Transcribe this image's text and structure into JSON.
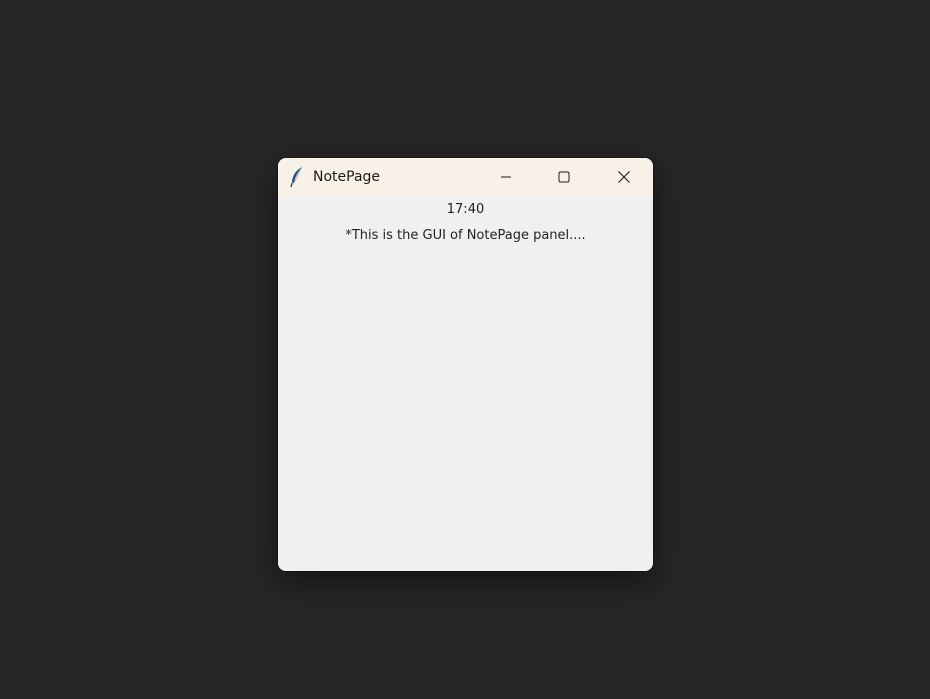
{
  "window": {
    "title": "NotePage",
    "icon": "feather-icon",
    "controls": {
      "minimize": "minimize-icon",
      "maximize": "maximize-icon",
      "close": "close-icon"
    }
  },
  "content": {
    "time": "17:40",
    "message": "*This is the GUI of NotePage panel...."
  },
  "colors": {
    "desktop": "#272727",
    "titlebar": "#f8f1e8",
    "window_body": "#f0f0f0",
    "text": "#222222"
  }
}
